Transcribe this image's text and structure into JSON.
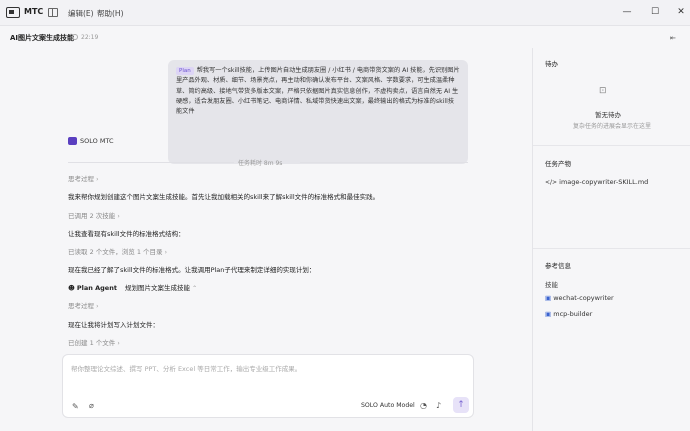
{
  "titlebar": {
    "app_name": "MTC",
    "menu": [
      "编辑(E)",
      "帮助(H)"
    ],
    "minimize": "—",
    "maximize": "☐",
    "close": "✕"
  },
  "header": {
    "title": "AI图片文案生成技能",
    "time": "22:19",
    "expand_icon": "⇤"
  },
  "conversation": {
    "plan_tag": "Plan",
    "user_message": "帮我写一个skill技能，上传图片自动生成朋友圈 / 小红书 / 电商带货文案的 AI 技能，先识别图片里产品外观、材质、细节、场景亮点，再主动和你确认发布平台、文案风格、字数要求，可生成温柔种草、简约高级、接地气带货多版本文案，严格只依据图片真实信息创作，不虚构卖点，语言自然无 AI 生硬感，适合发朋友圈、小红书笔记、电商详情、私域带货快速出文案，最终输出的格式为标准的skill技能文件",
    "agent_name": "SOLO MTC",
    "divider_text": "任务耗时 8m 9s",
    "steps": [
      {
        "text": "思考过程",
        "style": "muted",
        "chevron": "›"
      },
      {
        "text": "我来帮你规划创建这个图片文案生成技能。首先让我加载相关的skill来了解skill文件的标准格式和最佳实践。",
        "style": "strong"
      },
      {
        "text": "已调用 2 次技能",
        "style": "muted",
        "chevron": "›"
      },
      {
        "text": "让我查看现有skill文件的标准格式结构：",
        "style": "strong"
      },
      {
        "text": "已读取 2 个文件，浏览 1 个目录",
        "style": "muted",
        "chevron": "›"
      },
      {
        "text": "现在我已经了解了skill文件的标准格式。让我调用Plan子代理来制定详细的实现计划：",
        "style": "strong"
      },
      {
        "text": "Plan Agent",
        "style": "agent",
        "sub": "规划图片文案生成技能",
        "chevron": "⌃"
      },
      {
        "text": "思考过程",
        "style": "muted",
        "chevron": "›"
      },
      {
        "text": "现在让我将计划写入计划文件：",
        "style": "strong"
      },
      {
        "text": "已创建 1 个文件",
        "style": "muted",
        "chevron": "›"
      }
    ]
  },
  "input": {
    "placeholder": "帮你整理论文综述、撰写 PPT、分析 Excel 等日常工作，输出专业级工作成果。",
    "model": "SOLO Auto Model",
    "send_icon": "↑"
  },
  "sidebar": {
    "todo_title": "待办",
    "todo_empty_title": "暂无待办",
    "todo_empty_desc": "复杂任务的进展会显示在这里",
    "outputs_title": "任务产物",
    "outputs": [
      "image-copywriter-SKILL.md"
    ],
    "ref_title": "参考信息",
    "skills_title": "技能",
    "skills": [
      "wechat-copywriter",
      "mcp-builder"
    ]
  }
}
